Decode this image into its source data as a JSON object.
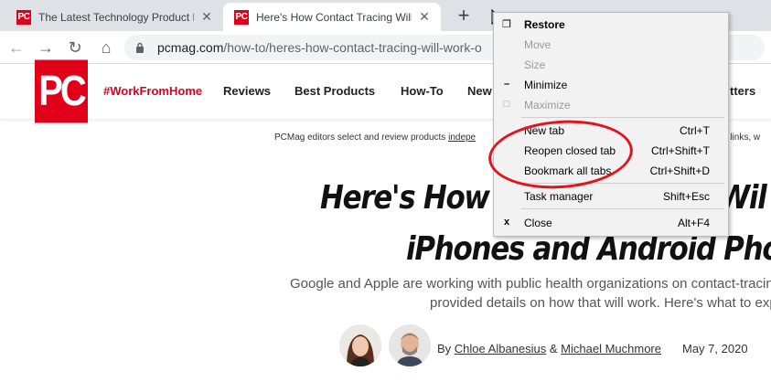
{
  "tabs": [
    {
      "favicon": "PC",
      "title": "The Latest Technology Product R",
      "close": "✕"
    },
    {
      "favicon": "PC",
      "title": "Here's How Contact Tracing Will ",
      "close": "✕"
    }
  ],
  "new_tab_glyph": "+",
  "nav": {
    "back": "←",
    "forward": "→",
    "reload": "↻",
    "home": "⌂"
  },
  "url": {
    "domain": "pcmag.com",
    "path": "/how-to/heres-how-contact-tracing-will-work-o"
  },
  "site": {
    "logo": "PC",
    "nav_links": [
      "#WorkFromHome",
      "Reviews",
      "Best Products",
      "How-To",
      "New",
      "tters"
    ]
  },
  "article": {
    "disclaimer_left": "PCMag editors select and review products ",
    "disclaimer_link": "indepe",
    "disclaimer_right": "g links, w",
    "headline_line1": "Here's How ",
    "headline_line1_right": "Wil",
    "headline_line2": "iPhones and Android Pho",
    "dek_line1": "Google and Apple are working with public health organizations on contact-tracin",
    "dek_line2": "provided details on how that will work. Here's what to exp",
    "byline_prefix": "By ",
    "author1": "Chloe Albanesius",
    "byline_join": " & ",
    "author2": "Michael Muchmore",
    "date": "May 7, 2020"
  },
  "system_menu": {
    "items": [
      {
        "glyph": "❐",
        "label": "Restore",
        "accel": "",
        "bold": true,
        "disabled": false
      },
      {
        "glyph": "",
        "label": "Move",
        "accel": "",
        "bold": false,
        "disabled": true
      },
      {
        "glyph": "",
        "label": "Size",
        "accel": "",
        "bold": false,
        "disabled": true
      },
      {
        "glyph": "–",
        "label": "Minimize",
        "accel": "",
        "bold": false,
        "disabled": false
      },
      {
        "glyph": "□",
        "label": "Maximize",
        "accel": "",
        "bold": false,
        "disabled": true
      },
      {
        "glyph": "",
        "label": "New tab",
        "accel": "Ctrl+T",
        "bold": false,
        "disabled": false
      },
      {
        "glyph": "",
        "label": "Reopen closed tab",
        "accel": "Ctrl+Shift+T",
        "bold": false,
        "disabled": false
      },
      {
        "glyph": "",
        "label": "Bookmark all tabs",
        "accel": "Ctrl+Shift+D",
        "bold": false,
        "disabled": false
      },
      {
        "glyph": "",
        "label": "Task manager",
        "accel": "Shift+Esc",
        "bold": false,
        "disabled": false
      },
      {
        "glyph": "x",
        "label": "Close",
        "accel": "Alt+F4",
        "bold": false,
        "disabled": false
      }
    ]
  },
  "colors": {
    "brand": "#e0001a",
    "annotation": "#e2141c",
    "tabstrip": "#dee1e6"
  }
}
